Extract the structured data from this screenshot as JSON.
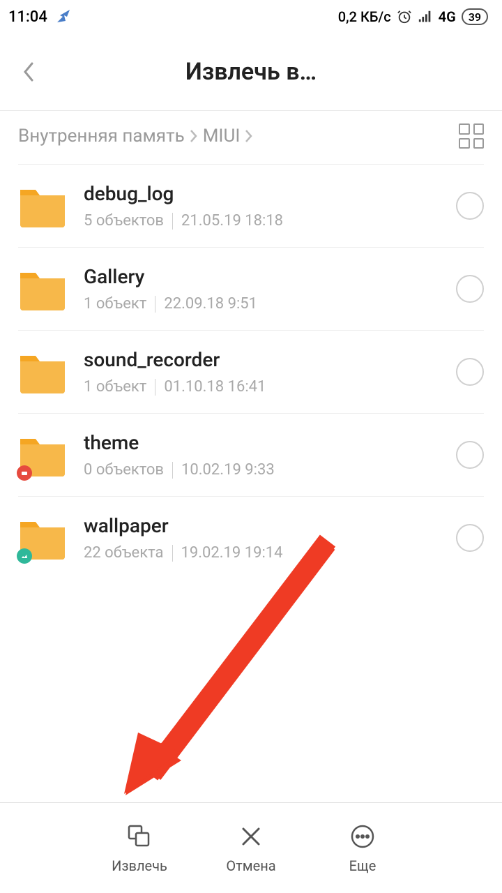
{
  "statusbar": {
    "time": "11:04",
    "data_rate": "0,2 КБ/с",
    "network": "4G",
    "battery": "39"
  },
  "header": {
    "title": "Извлечь в…"
  },
  "breadcrumb": {
    "segments": [
      "Внутренняя память",
      "MIUI"
    ]
  },
  "files": [
    {
      "name": "debug_log",
      "count": "5 объектов",
      "date": "21.05.19 18:18",
      "badge": ""
    },
    {
      "name": "Gallery",
      "count": "1 объект",
      "date": "22.09.18 9:51",
      "badge": ""
    },
    {
      "name": "sound_recorder",
      "count": "1 объект",
      "date": "01.10.18 16:41",
      "badge": ""
    },
    {
      "name": "theme",
      "count": "0 объектов",
      "date": "10.02.19 9:33",
      "badge": "red"
    },
    {
      "name": "wallpaper",
      "count": "22 объекта",
      "date": "19.02.19 19:14",
      "badge": "teal"
    }
  ],
  "bottombar": {
    "extract": "Извлечь",
    "cancel": "Отмена",
    "more": "Еще"
  }
}
